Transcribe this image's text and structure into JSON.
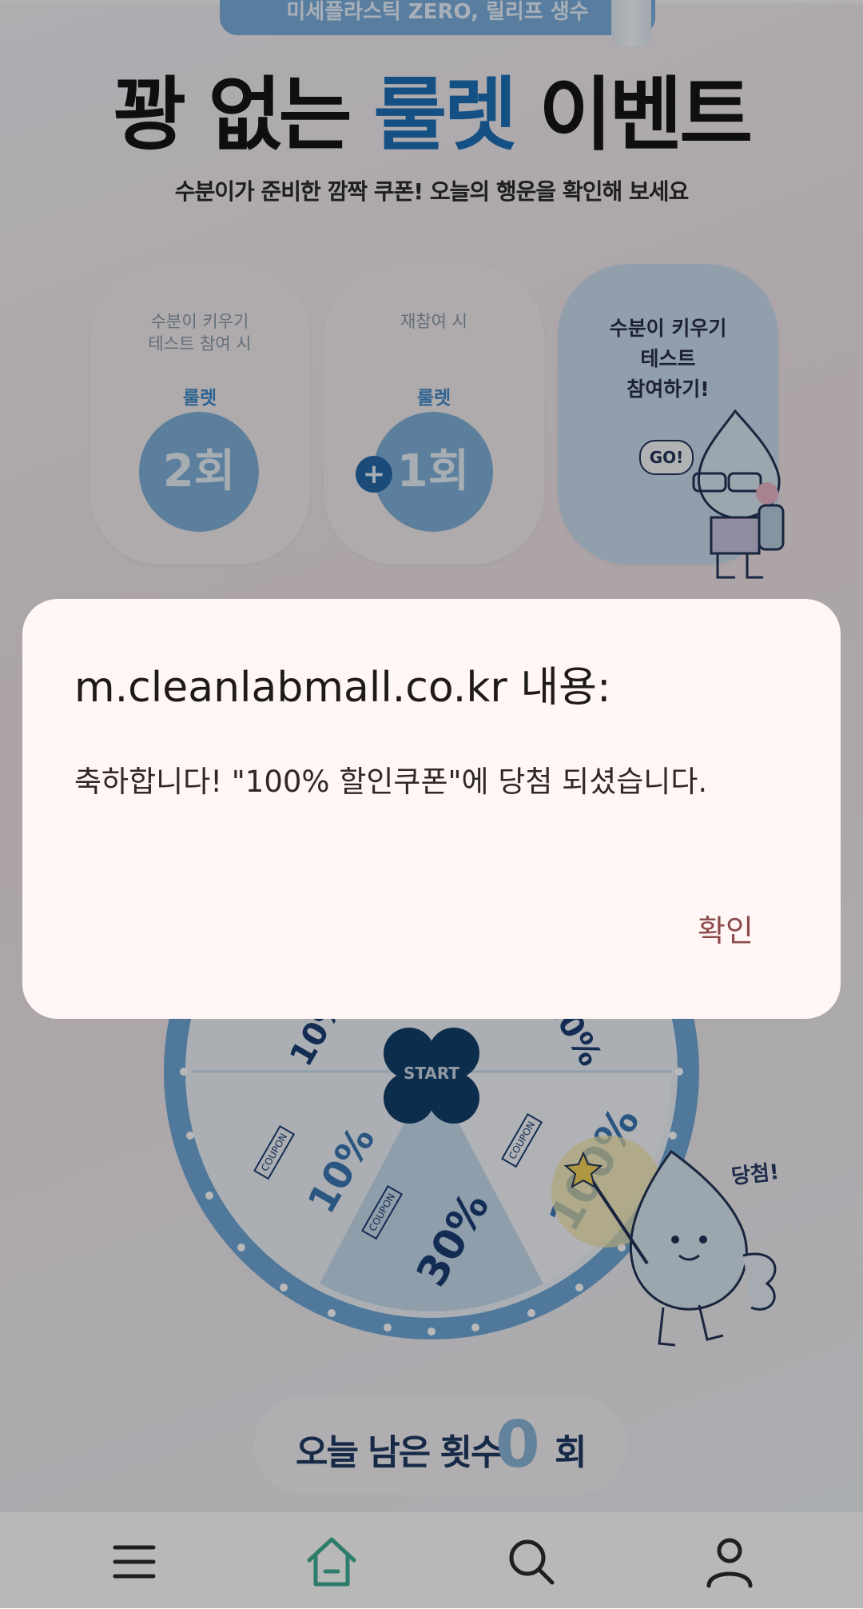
{
  "promo": {
    "banner_text": "미세플라스틱 ZERO, 릴리프 생수"
  },
  "hero": {
    "title_prefix": "꽝 없는 ",
    "title_accent": "룰렛",
    "title_suffix": " 이벤트",
    "subtitle": "수분이가 준비한 깜짝 쿠폰! 오늘의 행운을 확인해 보세요"
  },
  "cards": [
    {
      "caption_line1": "수분이 키우기",
      "caption_line2": "테스트 참여 시",
      "label": "룰렛",
      "value": "2회"
    },
    {
      "caption_line1": "재참여 시",
      "label": "룰렛",
      "badge": "+",
      "value": "1회"
    },
    {
      "cta_line1": "수분이 키우기",
      "cta_line2": "테스트",
      "cta_line3": "참여하기!",
      "bubble": "GO!"
    }
  ],
  "wheel": {
    "start_label": "START",
    "coupon_text": "COUPON",
    "slices": [
      "10%",
      "30%",
      "100%"
    ],
    "win_text": "당첨!"
  },
  "remaining": {
    "label": "오늘 남은 횟수",
    "count": "0",
    "unit": "회"
  },
  "nav": {
    "items": [
      "menu-icon",
      "home-icon",
      "search-icon",
      "user-icon"
    ]
  },
  "dialog": {
    "title": "m.cleanlabmall.co.kr 내용:",
    "message": "축하합니다! \"100% 할인쿠폰\"에 당첨 되셨습니다.",
    "confirm_label": "확인"
  },
  "colors": {
    "accent": "#1d6fb8",
    "dialog_bg": "#fff6f5",
    "confirm": "#8b4a4a"
  }
}
